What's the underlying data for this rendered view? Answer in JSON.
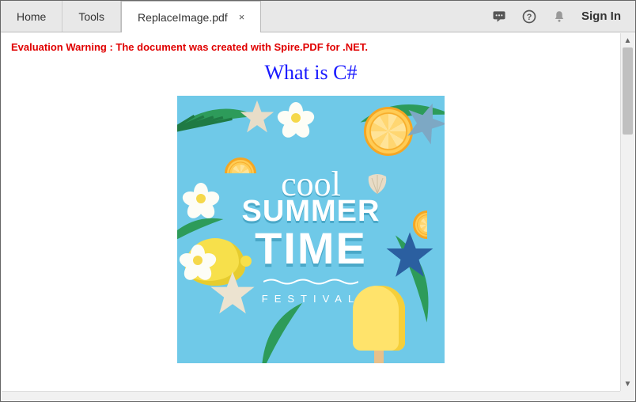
{
  "toolbar": {
    "tabs": [
      {
        "label": "Home"
      },
      {
        "label": "Tools"
      },
      {
        "label": "ReplaceImage.pdf",
        "close": "×"
      }
    ],
    "signin": "Sign In"
  },
  "doc": {
    "warning": "Evaluation Warning : The document was created with Spire.PDF for .NET.",
    "title": "What is C#",
    "poster": {
      "cool": "cool",
      "summer": "SUMMER",
      "time": "TIME",
      "festival": "FESTIVAL"
    }
  }
}
